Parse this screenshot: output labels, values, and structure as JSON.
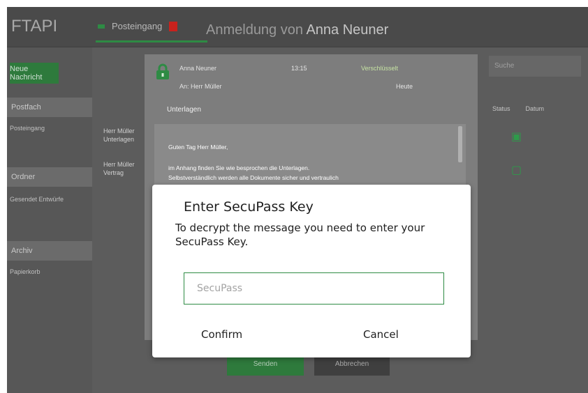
{
  "app": {
    "logo": "FTAPI",
    "nav": {
      "mailbox_label": "Posteingang"
    },
    "greeting_prefix": "Anmeldung von",
    "user_name": "Anna Neuner"
  },
  "sidebar": {
    "new_button": "Neue Nachricht",
    "section1": "Postfach",
    "line1": "Posteingang",
    "section2": "Ordner",
    "line2": "Gesendet Entwürfe",
    "section3": "Archiv",
    "line3": "Papierkorb"
  },
  "mail_list": {
    "search_placeholder": "Suche",
    "col_status": "Status",
    "col_date": "Datum",
    "rows": [
      {
        "sender": "Herr Müller",
        "snippet": "Unterlagen"
      },
      {
        "sender": "Herr Müller",
        "snippet": "Vertrag"
      }
    ]
  },
  "viewer": {
    "from": "Anna Neuner",
    "time": "13:15",
    "badge": "Verschlüsselt",
    "to": "An: Herr Müller",
    "date": "Heute",
    "subject": "Unterlagen",
    "body": [
      "Guten Tag Herr Müller,",
      "im Anhang finden Sie wie besprochen die Unterlagen.",
      "Selbstverständlich werden alle Dokumente sicher und vertraulich"
    ]
  },
  "footer": {
    "primary_button": "Senden",
    "secondary_button": "Abbrechen"
  },
  "dialog": {
    "title": "Enter SecuPass Key",
    "message": "To decrypt the message you need to enter your SecuPass Key.",
    "input_placeholder": "SecuPass",
    "confirm": "Confirm",
    "cancel": "Cancel"
  },
  "colors": {
    "accent": "#2e8b44",
    "overlay": "#5e5e5e"
  }
}
